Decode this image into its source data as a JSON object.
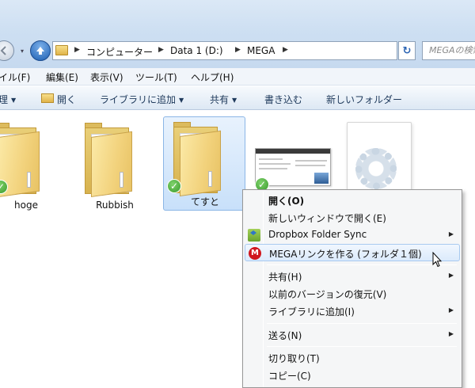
{
  "address_bar": {
    "breadcrumbs": [
      "コンピューター",
      "Data 1 (D:)",
      "MEGA"
    ],
    "search_placeholder": "MEGAの検索"
  },
  "menubar": {
    "items": [
      "イル(F)",
      "編集(E)",
      "表示(V)",
      "ツール(T)",
      "ヘルプ(H)"
    ]
  },
  "command_bar": {
    "items": [
      "理",
      "開く",
      "ライブラリに追加",
      "共有",
      "書き込む",
      "新しいフォルダー"
    ]
  },
  "files": [
    {
      "name": "hoge",
      "icon": "folder-icon",
      "synced": true
    },
    {
      "name": "Rubbish",
      "icon": "folder-icon",
      "synced": false
    },
    {
      "name": "てすと",
      "icon": "folder-icon",
      "synced": true,
      "selected": true
    },
    {
      "name": "",
      "icon": "document-thumbnail-icon",
      "synced": true
    },
    {
      "name": "",
      "icon": "settings-file-icon",
      "synced": false
    }
  ],
  "context_menu": {
    "items": [
      {
        "label": "開く(O)",
        "bold": true
      },
      {
        "label": "新しいウィンドウで開く(E)"
      },
      {
        "label": "Dropbox Folder Sync",
        "icon": "dropbox-icon",
        "submenu": true
      },
      {
        "label": "MEGAリンクを作る (フォルダ１個)",
        "icon": "mega-icon",
        "highlighted": true
      },
      {
        "label": "共有(H)",
        "submenu": true
      },
      {
        "label": "以前のバージョンの復元(V)"
      },
      {
        "label": "ライブラリに追加(I)",
        "submenu": true
      },
      {
        "label": "送る(N)",
        "submenu": true
      },
      {
        "label": "切り取り(T)"
      },
      {
        "label": "コピー(C)"
      }
    ]
  },
  "colors": {
    "titlebar": "#cddff2",
    "selection": "#c8e0fa",
    "sync_badge": "#3a9a2d",
    "mega_red": "#d0161e",
    "menu_background": "#f5f6f7"
  }
}
